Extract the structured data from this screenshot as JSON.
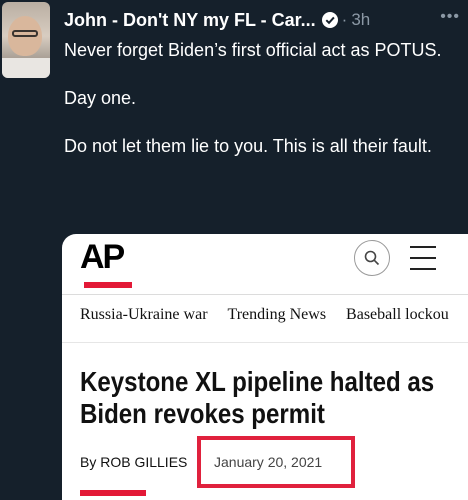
{
  "tweet": {
    "display_name": "John - Don't NY my FL - Car...",
    "timestamp": "3h",
    "separator": "·",
    "more_label": "•••",
    "paragraphs": [
      "Never forget Biden’s first official act as POTUS.",
      "Day one.",
      "Do not let them lie to you. This is all their fault."
    ]
  },
  "article_card": {
    "logo_text": "AP",
    "nav_items": [
      "Russia-Ukraine war",
      "Trending News",
      "Baseball lockou"
    ],
    "headline": "Keystone XL pipeline halted as Biden revokes permit",
    "byline": "By ROB GILLIES",
    "date": "January 20, 2021"
  },
  "icons": {
    "verified": "verified-badge-icon",
    "more": "more-horizontal-icon",
    "search": "search-icon",
    "menu": "hamburger-menu-icon"
  },
  "colors": {
    "background": "#15202b",
    "ap_red": "#e31937",
    "highlight_red": "#e0213d",
    "muted": "#8b98a5"
  }
}
